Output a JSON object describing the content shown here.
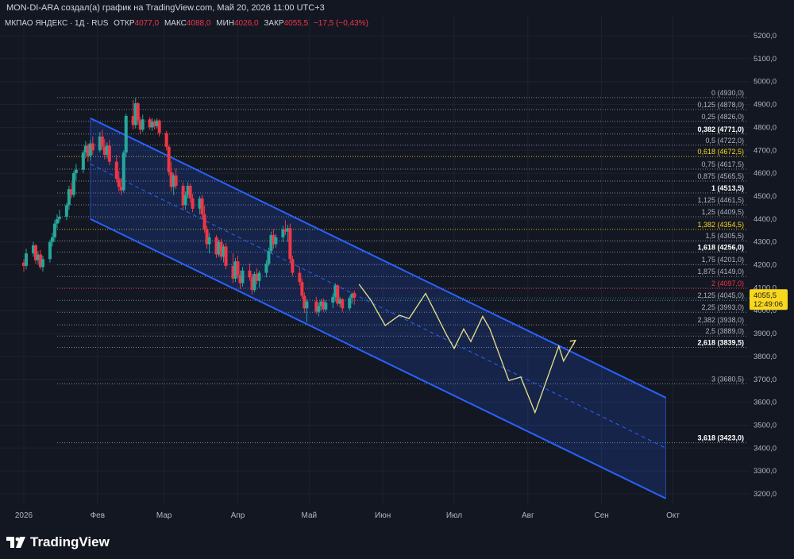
{
  "header": {
    "attribution": "MON-DI-ARA создал(а) график на TradingView.com, Май 20, 2026 11:00 UTC+3"
  },
  "legend": {
    "symbol": "МКПАО ЯНДЕКС · 1Д · RUS",
    "open_label": "ОТКР",
    "open_value": "4077,0",
    "high_label": "МАКС",
    "high_value": "4088,0",
    "low_label": "МИН",
    "low_value": "4026,0",
    "close_label": "ЗАКР",
    "close_value": "4055,5",
    "change": "−17,5 (−0,43%)"
  },
  "brand": {
    "name": "TradingView",
    "logo_icon": "tradingview-logo-icon"
  },
  "colors": {
    "background": "#131722",
    "up": "#26a69a",
    "down": "#f23645",
    "channel": "#2962ff",
    "projection": "#e8e38a",
    "price_badge": "#f9d71c"
  },
  "chart_data": {
    "type": "candlestick",
    "ylim": [
      3150,
      5250
    ],
    "yticks": [
      "5200,0",
      "5100,0",
      "5000,0",
      "4900,0",
      "4800,0",
      "4700,0",
      "4600,0",
      "4500,0",
      "4400,0",
      "4300,0",
      "4200,0",
      "4100,0",
      "4000,0",
      "3900,0",
      "3800,0",
      "3700,0",
      "3600,0",
      "3500,0",
      "3400,0",
      "3300,0",
      "3200,0"
    ],
    "ytick_values": [
      5200,
      5100,
      5000,
      4900,
      4800,
      4700,
      4600,
      4500,
      4400,
      4300,
      4200,
      4100,
      4000,
      3900,
      3800,
      3700,
      3600,
      3500,
      3400,
      3300,
      3200
    ],
    "xticks": [
      {
        "label": "2026",
        "date": "2026-01-01"
      },
      {
        "label": "Фев",
        "date": "2026-02-01"
      },
      {
        "label": "Мар",
        "date": "2026-03-01"
      },
      {
        "label": "Апр",
        "date": "2026-04-01"
      },
      {
        "label": "Май",
        "date": "2026-05-01"
      },
      {
        "label": "Июн",
        "date": "2026-06-01"
      },
      {
        "label": "Июл",
        "date": "2026-07-01"
      },
      {
        "label": "Авг",
        "date": "2026-08-01"
      },
      {
        "label": "Сен",
        "date": "2026-09-01"
      },
      {
        "label": "Окт",
        "date": "2026-10-01"
      }
    ],
    "current_price": {
      "value": 4055.5,
      "label": "4055,5",
      "time": "12:49:06"
    },
    "fib_levels": [
      {
        "ratio": "0",
        "value": 4930.0,
        "label": "0 (4930,0)",
        "style": "normal"
      },
      {
        "ratio": "0,125",
        "value": 4878.0,
        "label": "0,125 (4878,0)",
        "style": "normal"
      },
      {
        "ratio": "0,25",
        "value": 4826.0,
        "label": "0,25 (4826,0)",
        "style": "normal"
      },
      {
        "ratio": "0,382",
        "value": 4771.0,
        "label": "0,382 (4771,0)",
        "style": "bold"
      },
      {
        "ratio": "0,5",
        "value": 4722.0,
        "label": "0,5 (4722,0)",
        "style": "normal"
      },
      {
        "ratio": "0,618",
        "value": 4672.5,
        "label": "0,618 (4672,5)",
        "style": "yellow"
      },
      {
        "ratio": "0,75",
        "value": 4617.5,
        "label": "0,75 (4617,5)",
        "style": "normal"
      },
      {
        "ratio": "0,875",
        "value": 4565.5,
        "label": "0,875 (4565,5)",
        "style": "normal"
      },
      {
        "ratio": "1",
        "value": 4513.5,
        "label": "1 (4513,5)",
        "style": "bold"
      },
      {
        "ratio": "1,125",
        "value": 4461.5,
        "label": "1,125 (4461,5)",
        "style": "normal"
      },
      {
        "ratio": "1,25",
        "value": 4409.5,
        "label": "1,25 (4409,5)",
        "style": "normal"
      },
      {
        "ratio": "1,382",
        "value": 4354.5,
        "label": "1,382 (4354,5)",
        "style": "yellow"
      },
      {
        "ratio": "1,5",
        "value": 4305.5,
        "label": "1,5 (4305,5)",
        "style": "normal"
      },
      {
        "ratio": "1,618",
        "value": 4256.0,
        "label": "1,618 (4256,0)",
        "style": "bold"
      },
      {
        "ratio": "1,75",
        "value": 4201.0,
        "label": "1,75 (4201,0)",
        "style": "normal"
      },
      {
        "ratio": "1,875",
        "value": 4149.0,
        "label": "1,875 (4149,0)",
        "style": "normal"
      },
      {
        "ratio": "2",
        "value": 4097.0,
        "label": "2 (4097,0)",
        "style": "red"
      },
      {
        "ratio": "2,125",
        "value": 4045.0,
        "label": "2,125 (4045,0)",
        "style": "normal"
      },
      {
        "ratio": "2,25",
        "value": 3993.0,
        "label": "2,25 (3993,0)",
        "style": "normal"
      },
      {
        "ratio": "2,382",
        "value": 3938.0,
        "label": "2,382 (3938,0)",
        "style": "normal"
      },
      {
        "ratio": "2,5",
        "value": 3889.0,
        "label": "2,5 (3889,0)",
        "style": "normal"
      },
      {
        "ratio": "2,618",
        "value": 3839.5,
        "label": "2,618 (3839,5)",
        "style": "bold"
      },
      {
        "ratio": "3",
        "value": 3680.5,
        "label": "3 (3680,5)",
        "style": "normal"
      },
      {
        "ratio": "3,618",
        "value": 3423.0,
        "label": "3,618 (3423,0)",
        "style": "bold"
      }
    ],
    "channel": {
      "start_date": "2026-01-29",
      "end_date": "2026-09-28",
      "upper": [
        4840,
        3620
      ],
      "middle": [
        4640,
        3400
      ],
      "lower": [
        4400,
        3180
      ]
    },
    "projection_path": [
      [
        "2026-05-22",
        4115
      ],
      [
        "2026-05-27",
        4045
      ],
      [
        "2026-06-02",
        3935
      ],
      [
        "2026-06-08",
        3980
      ],
      [
        "2026-06-12",
        3965
      ],
      [
        "2026-06-19",
        4075
      ],
      [
        "2026-06-28",
        3890
      ],
      [
        "2026-07-01",
        3835
      ],
      [
        "2026-07-05",
        3920
      ],
      [
        "2026-07-08",
        3865
      ],
      [
        "2026-07-13",
        3975
      ],
      [
        "2026-07-16",
        3920
      ],
      [
        "2026-07-24",
        3695
      ],
      [
        "2026-07-29",
        3710
      ],
      [
        "2026-08-04",
        3555
      ],
      [
        "2026-08-14",
        3845
      ],
      [
        "2026-08-16",
        3780
      ],
      [
        "2026-08-21",
        3870
      ]
    ],
    "candles": [
      [
        "2026-01-01",
        4210,
        4225,
        4170,
        4195
      ],
      [
        "2026-01-02",
        4195,
        4270,
        4180,
        4250
      ],
      [
        "2026-01-05",
        4250,
        4300,
        4235,
        4285
      ],
      [
        "2026-01-06",
        4285,
        4290,
        4205,
        4220
      ],
      [
        "2026-01-07",
        4220,
        4260,
        4200,
        4245
      ],
      [
        "2026-01-08",
        4245,
        4265,
        4180,
        4190
      ],
      [
        "2026-01-09",
        4190,
        4240,
        4170,
        4225
      ],
      [
        "2026-01-12",
        4225,
        4310,
        4210,
        4300
      ],
      [
        "2026-01-13",
        4300,
        4340,
        4280,
        4320
      ],
      [
        "2026-01-14",
        4320,
        4395,
        4300,
        4380
      ],
      [
        "2026-01-15",
        4380,
        4420,
        4360,
        4400
      ],
      [
        "2026-01-16",
        4400,
        4440,
        4385,
        4410
      ],
      [
        "2026-01-19",
        4410,
        4470,
        4395,
        4460
      ],
      [
        "2026-01-20",
        4460,
        4545,
        4440,
        4530
      ],
      [
        "2026-01-21",
        4530,
        4560,
        4490,
        4505
      ],
      [
        "2026-01-22",
        4505,
        4610,
        4495,
        4600
      ],
      [
        "2026-01-23",
        4600,
        4640,
        4570,
        4615
      ],
      [
        "2026-01-26",
        4615,
        4700,
        4600,
        4690
      ],
      [
        "2026-01-27",
        4690,
        4740,
        4665,
        4720
      ],
      [
        "2026-01-28",
        4720,
        4730,
        4650,
        4675
      ],
      [
        "2026-01-29",
        4675,
        4745,
        4655,
        4730
      ],
      [
        "2026-01-30",
        4730,
        4760,
        4680,
        4700
      ],
      [
        "2026-02-02",
        4700,
        4780,
        4690,
        4760
      ],
      [
        "2026-02-03",
        4760,
        4790,
        4700,
        4715
      ],
      [
        "2026-02-04",
        4715,
        4750,
        4660,
        4680
      ],
      [
        "2026-02-05",
        4680,
        4735,
        4665,
        4720
      ],
      [
        "2026-02-06",
        4720,
        4745,
        4635,
        4650
      ],
      [
        "2026-02-09",
        4650,
        4680,
        4560,
        4575
      ],
      [
        "2026-02-10",
        4575,
        4610,
        4520,
        4540
      ],
      [
        "2026-02-11",
        4540,
        4580,
        4505,
        4525
      ],
      [
        "2026-02-12",
        4525,
        4700,
        4515,
        4690
      ],
      [
        "2026-02-13",
        4690,
        4860,
        4670,
        4850
      ],
      [
        "2026-02-16",
        4850,
        4920,
        4790,
        4810
      ],
      [
        "2026-02-17",
        4810,
        4930,
        4795,
        4905
      ],
      [
        "2026-02-18",
        4905,
        4910,
        4810,
        4830
      ],
      [
        "2026-02-19",
        4830,
        4845,
        4770,
        4790
      ],
      [
        "2026-02-20",
        4790,
        4855,
        4780,
        4835
      ],
      [
        "2026-02-23",
        4835,
        4845,
        4790,
        4800
      ],
      [
        "2026-02-24",
        4800,
        4840,
        4785,
        4825
      ],
      [
        "2026-02-25",
        4825,
        4835,
        4790,
        4805
      ],
      [
        "2026-02-26",
        4805,
        4840,
        4795,
        4830
      ],
      [
        "2026-02-27",
        4830,
        4835,
        4760,
        4775
      ],
      [
        "2026-03-02",
        4775,
        4785,
        4700,
        4715
      ],
      [
        "2026-03-03",
        4715,
        4720,
        4590,
        4605
      ],
      [
        "2026-03-04",
        4605,
        4650,
        4520,
        4540
      ],
      [
        "2026-03-05",
        4540,
        4600,
        4505,
        4590
      ],
      [
        "2026-03-06",
        4590,
        4620,
        4530,
        4545
      ],
      [
        "2026-03-09",
        4545,
        4560,
        4440,
        4460
      ],
      [
        "2026-03-10",
        4460,
        4520,
        4440,
        4505
      ],
      [
        "2026-03-11",
        4505,
        4560,
        4490,
        4545
      ],
      [
        "2026-03-12",
        4545,
        4555,
        4470,
        4490
      ],
      [
        "2026-03-13",
        4490,
        4510,
        4430,
        4445
      ],
      [
        "2026-03-16",
        4445,
        4500,
        4420,
        4490
      ],
      [
        "2026-03-17",
        4490,
        4505,
        4400,
        4420
      ],
      [
        "2026-03-18",
        4420,
        4460,
        4340,
        4355
      ],
      [
        "2026-03-19",
        4355,
        4370,
        4270,
        4290
      ],
      [
        "2026-03-20",
        4290,
        4340,
        4250,
        4320
      ],
      [
        "2026-03-23",
        4320,
        4330,
        4230,
        4245
      ],
      [
        "2026-03-24",
        4245,
        4310,
        4235,
        4300
      ],
      [
        "2026-03-25",
        4300,
        4315,
        4220,
        4235
      ],
      [
        "2026-03-26",
        4235,
        4290,
        4210,
        4280
      ],
      [
        "2026-03-27",
        4280,
        4295,
        4180,
        4195
      ],
      [
        "2026-03-30",
        4195,
        4250,
        4120,
        4140
      ],
      [
        "2026-03-31",
        4140,
        4230,
        4125,
        4215
      ],
      [
        "2026-04-01",
        4215,
        4240,
        4140,
        4155
      ],
      [
        "2026-04-02",
        4155,
        4175,
        4095,
        4120
      ],
      [
        "2026-04-03",
        4120,
        4190,
        4105,
        4175
      ],
      [
        "2026-04-06",
        4175,
        4205,
        4130,
        4145
      ],
      [
        "2026-04-07",
        4145,
        4160,
        4070,
        4090
      ],
      [
        "2026-04-08",
        4090,
        4170,
        4080,
        4160
      ],
      [
        "2026-04-09",
        4160,
        4185,
        4115,
        4130
      ],
      [
        "2026-04-10",
        4130,
        4175,
        4100,
        4165
      ],
      [
        "2026-04-13",
        4165,
        4220,
        4145,
        4205
      ],
      [
        "2026-04-14",
        4205,
        4275,
        4195,
        4260
      ],
      [
        "2026-04-15",
        4260,
        4345,
        4250,
        4330
      ],
      [
        "2026-04-16",
        4330,
        4355,
        4270,
        4290
      ],
      [
        "2026-04-17",
        4290,
        4335,
        4275,
        4320
      ],
      [
        "2026-04-20",
        4320,
        4370,
        4300,
        4355
      ],
      [
        "2026-04-21",
        4355,
        4395,
        4330,
        4345
      ],
      [
        "2026-04-22",
        4345,
        4375,
        4300,
        4360
      ],
      [
        "2026-04-23",
        4360,
        4380,
        4210,
        4225
      ],
      [
        "2026-04-24",
        4225,
        4240,
        4150,
        4165
      ],
      [
        "2026-04-27",
        4165,
        4190,
        4110,
        4125
      ],
      [
        "2026-04-28",
        4125,
        4140,
        4050,
        4065
      ],
      [
        "2026-04-29",
        4065,
        4080,
        3990,
        4010
      ],
      [
        "2026-04-30",
        4010,
        4050,
        3950,
        4040
      ],
      [
        "2026-05-04",
        4040,
        4060,
        3985,
        3995
      ],
      [
        "2026-05-05",
        3995,
        4035,
        3975,
        4020
      ],
      [
        "2026-05-06",
        4020,
        4050,
        4000,
        4040
      ],
      [
        "2026-05-07",
        4040,
        4055,
        3995,
        4005
      ],
      [
        "2026-05-08",
        4005,
        4045,
        3995,
        4035
      ],
      [
        "2026-05-11",
        4035,
        4075,
        4010,
        4060
      ],
      [
        "2026-05-12",
        4060,
        4120,
        4040,
        4110
      ],
      [
        "2026-05-13",
        4110,
        4115,
        4020,
        4030
      ],
      [
        "2026-05-14",
        4030,
        4060,
        4015,
        4050
      ],
      [
        "2026-05-15",
        4050,
        4055,
        3995,
        4010
      ],
      [
        "2026-05-18",
        4010,
        4065,
        4000,
        4055
      ],
      [
        "2026-05-19",
        4055,
        4080,
        4030,
        4073
      ],
      [
        "2026-05-20",
        4077,
        4088,
        4026,
        4055.5
      ]
    ]
  }
}
